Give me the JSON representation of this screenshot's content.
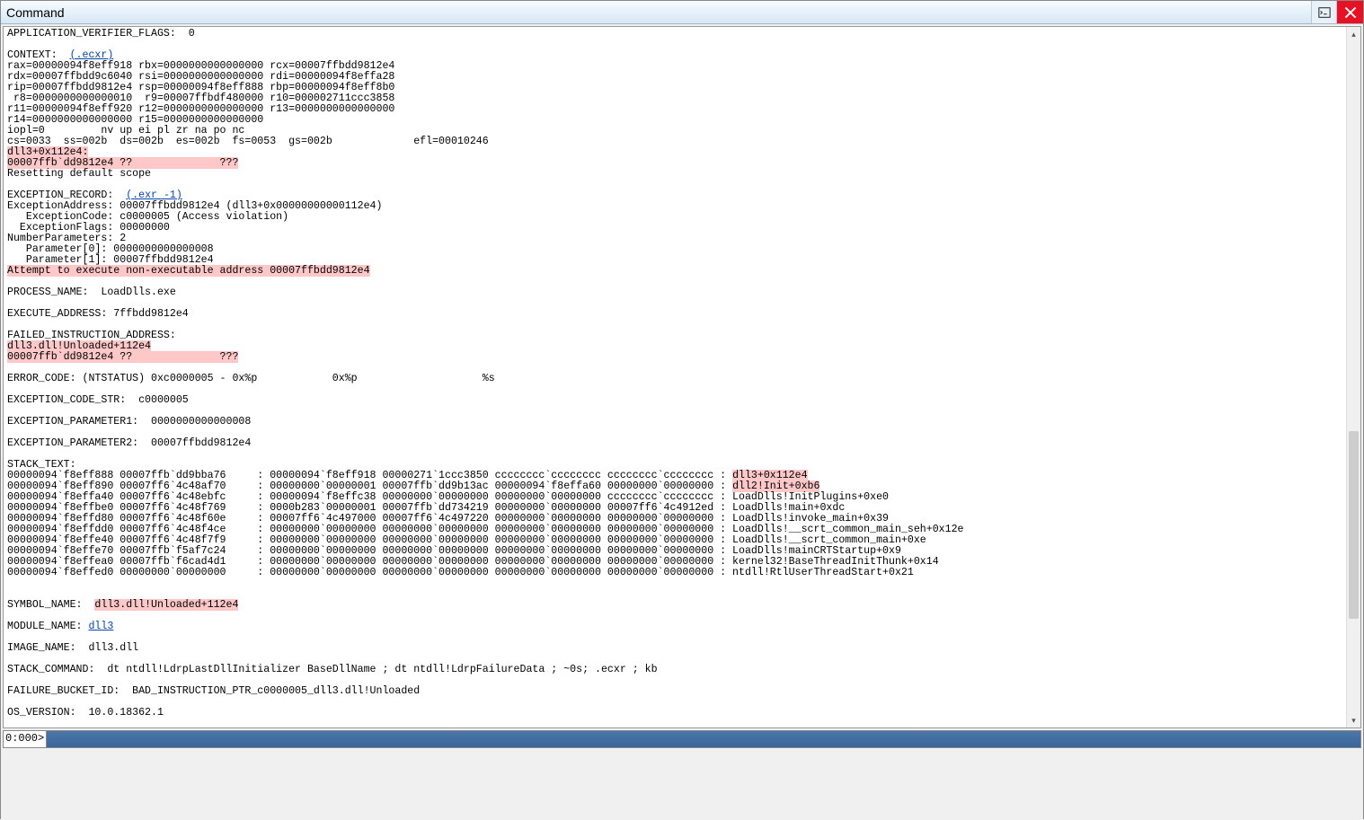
{
  "window": {
    "title": "Command",
    "close_tooltip": "Close"
  },
  "prompt": "0:000>",
  "links": {
    "ecxr": "(.ecxr)",
    "exr": "(.exr -1)",
    "dll3": "dll3"
  },
  "lines": {
    "l01": "APPLICATION_VERIFIER_FLAGS:  0",
    "l02": "",
    "l03": "CONTEXT:  ",
    "l04": "rax=00000094f8eff918 rbx=0000000000000000 rcx=00007ffbdd9812e4",
    "l05": "rdx=00007ffbdd9c6040 rsi=0000000000000000 rdi=00000094f8effa28",
    "l06": "rip=00007ffbdd9812e4 rsp=00000094f8eff888 rbp=00000094f8eff8b0",
    "l07": " r8=0000000000000010  r9=00007ffbdf480000 r10=000002711ccc3858",
    "l08": "r11=00000094f8eff920 r12=0000000000000000 r13=0000000000000000",
    "l09": "r14=0000000000000000 r15=0000000000000000",
    "l10": "iopl=0         nv up ei pl zr na po nc",
    "l11": "cs=0033  ss=002b  ds=002b  es=002b  fs=0053  gs=002b             efl=00010246",
    "l12": "dll3+0x112e4:",
    "l13": "00007ffb`dd9812e4 ??              ???",
    "l14": "Resetting default scope",
    "l15": "",
    "l16": "EXCEPTION_RECORD:  ",
    "l17": "ExceptionAddress: 00007ffbdd9812e4 (dll3+0x00000000000112e4)",
    "l18": "   ExceptionCode: c0000005 (Access violation)",
    "l19": "  ExceptionFlags: 00000000",
    "l20": "NumberParameters: 2",
    "l21": "   Parameter[0]: 0000000000000008",
    "l22": "   Parameter[1]: 00007ffbdd9812e4",
    "l23": "Attempt to execute non-executable address 00007ffbdd9812e4",
    "l24": "",
    "l25": "PROCESS_NAME:  LoadDlls.exe",
    "l26": "",
    "l27": "EXECUTE_ADDRESS: 7ffbdd9812e4",
    "l28": "",
    "l29": "FAILED_INSTRUCTION_ADDRESS: ",
    "l30": "dll3.dll!Unloaded+112e4",
    "l31": "00007ffb`dd9812e4 ??              ???",
    "l32": "",
    "l33": "ERROR_CODE: (NTSTATUS) 0xc0000005 - 0x%p            0x%p                    %s",
    "l34": "",
    "l35": "EXCEPTION_CODE_STR:  c0000005",
    "l36": "",
    "l37": "EXCEPTION_PARAMETER1:  0000000000000008",
    "l38": "",
    "l39": "EXCEPTION_PARAMETER2:  00007ffbdd9812e4",
    "l40": "",
    "l41": "STACK_TEXT:  ",
    "s1a": "00000094`f8eff888 00007ffb`dd9bba76     : 00000094`f8eff918 00000271`1ccc3850 cccccccc`cccccccc cccccccc`cccccccc : ",
    "s1b": "dll3+0x112e4",
    "s2a": "00000094`f8eff890 00007ff6`4c48af70     : 00000000`00000001 00007ffb`dd9b13ac 00000094`f8effa60 00000000`00000000 : ",
    "s2b": "dll2!Init+0xb6",
    "s3": "00000094`f8effa40 00007ff6`4c48ebfc     : 00000094`f8effc38 00000000`00000000 00000000`00000000 cccccccc`cccccccc : LoadDlls!InitPlugins+0xe0",
    "s4": "00000094`f8effbe0 00007ff6`4c48f769     : 0000b283`00000001 00007ffb`dd734219 00000000`00000000 00007ff6`4c4912ed : LoadDlls!main+0xdc",
    "s5": "00000094`f8effd80 00007ff6`4c48f60e     : 00007ff6`4c497000 00007ff6`4c497220 00000000`00000000 00000000`00000000 : LoadDlls!invoke_main+0x39",
    "s6": "00000094`f8effdd0 00007ff6`4c48f4ce     : 00000000`00000000 00000000`00000000 00000000`00000000 00000000`00000000 : LoadDlls!__scrt_common_main_seh+0x12e",
    "s7": "00000094`f8effe40 00007ff6`4c48f7f9     : 00000000`00000000 00000000`00000000 00000000`00000000 00000000`00000000 : LoadDlls!__scrt_common_main+0xe",
    "s8": "00000094`f8effe70 00007ffb`f5af7c24     : 00000000`00000000 00000000`00000000 00000000`00000000 00000000`00000000 : LoadDlls!mainCRTStartup+0x9",
    "s9": "00000094`f8effea0 00007ffb`f6cad4d1     : 00000000`00000000 00000000`00000000 00000000`00000000 00000000`00000000 : kernel32!BaseThreadInitThunk+0x14",
    "s10": "00000094`f8effed0 00000000`00000000     : 00000000`00000000 00000000`00000000 00000000`00000000 00000000`00000000 : ntdll!RtlUserThreadStart+0x21",
    "l60": "",
    "l61": "",
    "l62": "SYMBOL_NAME:  ",
    "l62b": "dll3.dll!Unloaded+112e4",
    "l63": "",
    "l64": "MODULE_NAME: ",
    "l65": "",
    "l66": "IMAGE_NAME:  dll3.dll",
    "l67": "",
    "l68": "STACK_COMMAND:  dt ntdll!LdrpLastDllInitializer BaseDllName ; dt ntdll!LdrpFailureData ; ~0s; .ecxr ; kb",
    "l69": "",
    "l70": "FAILURE_BUCKET_ID:  BAD_INSTRUCTION_PTR_c0000005_dll3.dll!Unloaded",
    "l71": "",
    "l72": "OS_VERSION:  10.0.18362.1"
  }
}
